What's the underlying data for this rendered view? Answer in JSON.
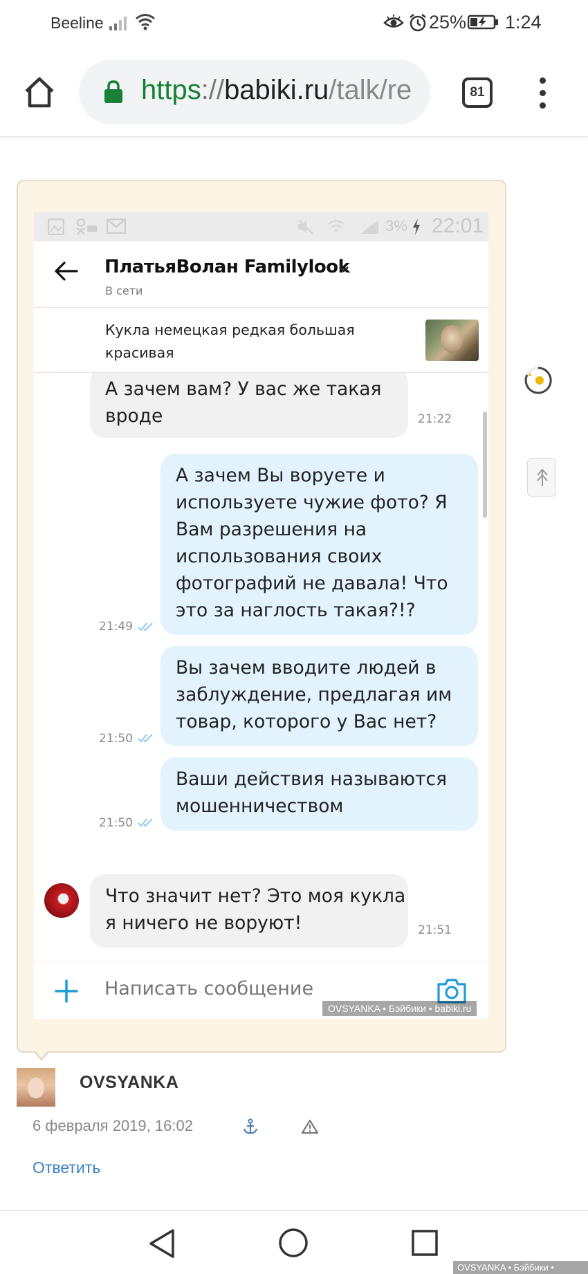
{
  "status_bar": {
    "carrier": "Beeline",
    "battery_percent": "25%",
    "clock": "1:24",
    "icons": [
      "signal-icon",
      "wifi-icon",
      "eye-comfort-icon",
      "alarm-icon",
      "battery-charging-icon"
    ]
  },
  "browser": {
    "url_scheme": "https",
    "url_sep": "://",
    "url_host": "babiki.ru",
    "url_path": "/talk/re",
    "tab_count": "81"
  },
  "chat": {
    "status_bar": {
      "battery": "3%",
      "time": "22:01"
    },
    "contact_name": "ПлатьяВолан Familylook",
    "contact_status": "В сети",
    "item_title": "Кукла немецкая редкая большая красивая",
    "messages": [
      {
        "dir": "in",
        "lines": [
          "А зачем вам? У вас же такая",
          "вроде"
        ],
        "time": "21:22"
      },
      {
        "dir": "out",
        "lines": [
          "А зачем Вы воруете и",
          "используете чужие фото? Я",
          "Вам разрешения на",
          "использования своих",
          "фотографий не давала! Что",
          "это за наглость такая?!?"
        ],
        "time": "21:49"
      },
      {
        "dir": "out",
        "lines": [
          "Вы зачем вводите людей в",
          "заблуждение, предлагая им",
          "товар, которого у Вас нет?"
        ],
        "time": "21:50"
      },
      {
        "dir": "out",
        "lines": [
          "Ваши действия называются",
          "мошенничеством"
        ],
        "time": "21:50"
      },
      {
        "dir": "in",
        "lines": [
          "Что значит нет? Это моя кукла",
          "я ничего не воруют!"
        ],
        "time": "21:51"
      }
    ],
    "compose_placeholder": "Написать сообщение",
    "watermark": "OVSYANKA • Бэйбики • babiki.ru"
  },
  "post": {
    "author": "OVSYANKA",
    "date": "6 февраля 2019, 16:02",
    "reply_label": "Ответить"
  },
  "footer_watermark": "OVSYANKA • Бэйбики • babiki.ru",
  "colors": {
    "card_bg": "#fcf5e6",
    "out_bubble": "#e2f3fd",
    "in_bubble": "#f1f1f1",
    "accent_blue": "#1e9bd7",
    "url_green": "#188038",
    "link_blue": "#3b7fc4"
  }
}
